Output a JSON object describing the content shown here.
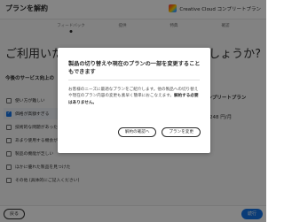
{
  "header": {
    "title": "プランを解約",
    "product": "Creative Cloud コンプリートプラン",
    "product_icon": "creative-cloud-logo-icon"
  },
  "steps": {
    "items": [
      {
        "label": "フィードバック",
        "active": true
      },
      {
        "label": "提供"
      },
      {
        "label": "特典"
      },
      {
        "label": "確認"
      }
    ]
  },
  "main": {
    "question_left": "ご利用いただ",
    "question_right": "でしょうか?",
    "subhead": "今後のサービス向上の",
    "options": [
      {
        "label": "使い方が難しい",
        "checked": false
      },
      {
        "label": "価格が高額すぎる",
        "checked": true
      },
      {
        "label": "技術的な問題があった",
        "checked": false
      },
      {
        "label": "あまり使用する機会がない",
        "checked": false
      },
      {
        "label": "製品の機能が乏しい",
        "checked": false
      },
      {
        "label": "ほかに優れた製品を見つけた",
        "checked": false
      },
      {
        "label": "その他 (具体的にご記入ください)",
        "checked": false
      }
    ],
    "plan_name": "コンプリートプラン",
    "plan_price": "248 円/月"
  },
  "footer": {
    "back_label": "戻る",
    "next_label": "続行"
  },
  "modal": {
    "title": "製品の切り替えや現在のプランの一部を変更することもできます",
    "body": "お客様のニーズに最適なプランをご紹介します。他の製品への切り替えや現在のプラン内容の変更も素早く簡単におこなえます。",
    "body_strong": "解約する必要はありません。",
    "confirm_cancel_label": "解約の確認へ",
    "change_plan_label": "プランを変更"
  },
  "colors": {
    "accent": "#1473e6",
    "overlay": "rgba(0,0,0,0.48)"
  }
}
